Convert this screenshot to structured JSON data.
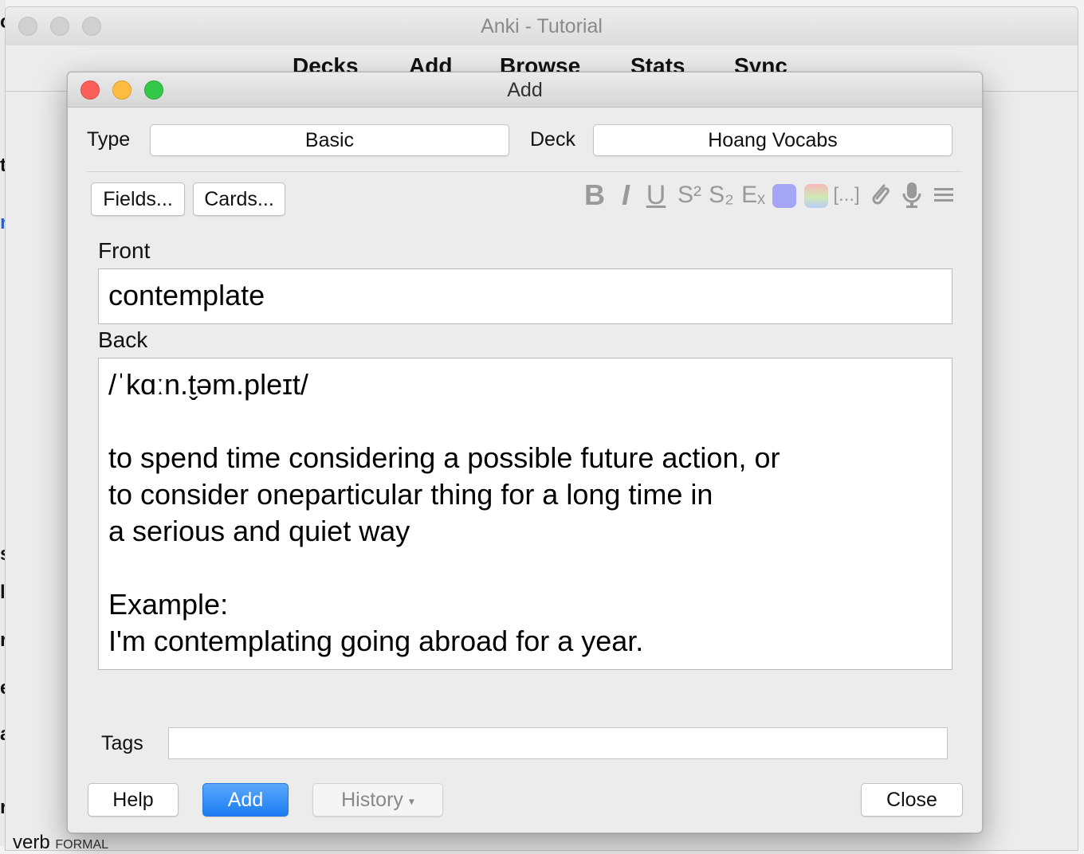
{
  "main_window": {
    "title": "Anki - Tutorial",
    "nav": [
      "Decks",
      "Add",
      "Browse",
      "Stats",
      "Sync"
    ],
    "left_fragments": [
      "o",
      "t",
      "r",
      "s",
      "l",
      "r",
      "e",
      "a",
      "r"
    ],
    "bottom_peek": {
      "word": "verb",
      "tag": "FORMAL"
    }
  },
  "dialog": {
    "title": "Add",
    "type_label": "Type",
    "type_value": "Basic",
    "deck_label": "Deck",
    "deck_value": "Hoang Vocabs",
    "fields_button": "Fields...",
    "cards_button": "Cards...",
    "toolbar": [
      {
        "icon": "bold-icon",
        "glyph": "B"
      },
      {
        "icon": "italic-icon",
        "glyph": "I"
      },
      {
        "icon": "underline-icon",
        "glyph": "U"
      },
      {
        "icon": "superscript-icon",
        "glyph": "S²"
      },
      {
        "icon": "subscript-icon",
        "glyph": "S₂"
      },
      {
        "icon": "clear-format-icon",
        "glyph": "Eₓ"
      },
      {
        "icon": "text-color-icon",
        "glyph": ""
      },
      {
        "icon": "highlight-color-icon",
        "glyph": ""
      },
      {
        "icon": "cloze-icon",
        "glyph": "[...]"
      },
      {
        "icon": "attach-icon",
        "glyph": "⌀"
      },
      {
        "icon": "record-audio-icon",
        "glyph": "🎙"
      },
      {
        "icon": "more-options-icon",
        "glyph": "≡"
      }
    ],
    "colors": {
      "text_color": "#a5a6f6",
      "accent": "#1b7cf1"
    },
    "front_label": "Front",
    "front_value": "contemplate",
    "back_label": "Back",
    "back_lines": [
      "/ˈkɑːn.t̬əm.pleɪt/",
      "",
      "to spend time considering a possible future action, or",
      "to consider oneparticular thing for a long time in",
      "a serious and quiet way",
      "",
      "Example:",
      "I'm contemplating going abroad for a year."
    ],
    "tags_label": "Tags",
    "tags_value": "",
    "help_button": "Help",
    "add_button": "Add",
    "history_button": "History",
    "history_arrow": "▾",
    "close_button": "Close"
  }
}
